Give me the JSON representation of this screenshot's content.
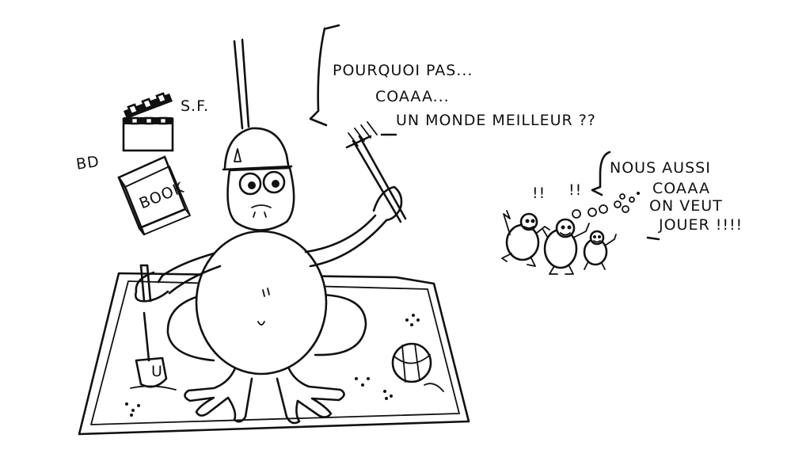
{
  "speech_frog": {
    "line1": "POURQUOI PAS...",
    "line2": "COAAA...",
    "line3": "UN MONDE MEILLEUR ??"
  },
  "speech_babies": {
    "line1": "NOUS AUSSI",
    "line2": "COAAA",
    "line3": "ON VEUT",
    "line4": "JOUER !!!!"
  },
  "labels": {
    "sf": "S.F.",
    "bd": "BD",
    "book": "BOOK",
    "shovel_letter": "U"
  },
  "exclamations": {
    "left": "!!",
    "right": "!!"
  },
  "colors": {
    "ink": "#111111",
    "paper": "#ffffff"
  }
}
